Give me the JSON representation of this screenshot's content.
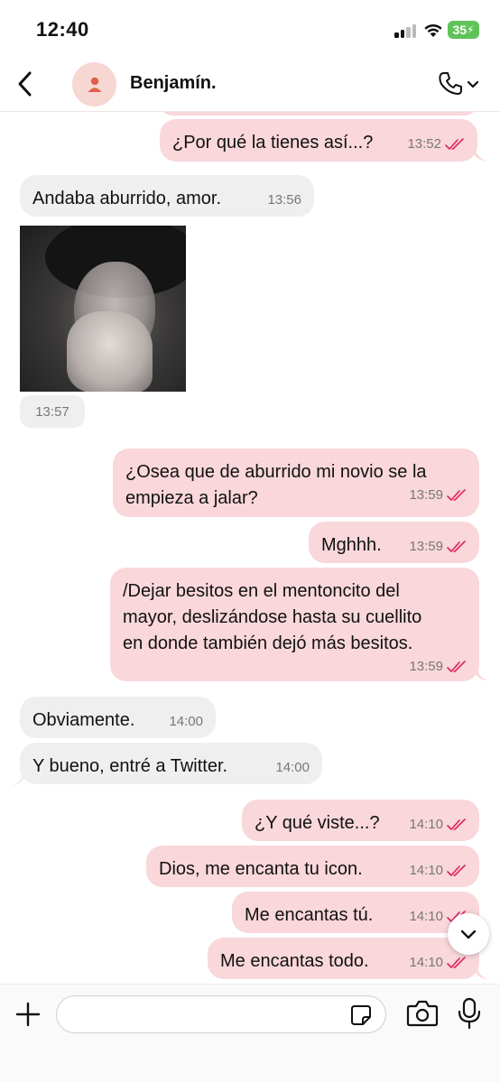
{
  "status_bar": {
    "time": "12:40",
    "battery": "35",
    "icons": [
      "signal-icon",
      "wifi-icon",
      "battery-charging-icon"
    ]
  },
  "header": {
    "contact_name": "Benjamín.",
    "icons": [
      "back-chevron-icon",
      "person-icon",
      "phone-icon",
      "chevron-down-icon"
    ]
  },
  "messages": [
    {
      "dir": "out",
      "text": "¿Por qué la tienes así...?",
      "time": "13:52",
      "read": true
    },
    {
      "dir": "in",
      "text": "Andaba aburrido, amor.",
      "time": "13:56"
    },
    {
      "dir": "in",
      "type": "photo",
      "time": "13:57"
    },
    {
      "dir": "out",
      "lines": [
        "¿Osea que de aburrido mi novio se la",
        "empieza a jalar?"
      ],
      "time": "13:59",
      "read": true
    },
    {
      "dir": "out",
      "text": "Mghhh.",
      "time": "13:59",
      "read": true
    },
    {
      "dir": "out",
      "lines": [
        "/Dejar besitos en el mentoncito del",
        "mayor, deslizándose hasta su cuellito",
        "en donde también dejó más besitos."
      ],
      "time": "13:59",
      "read": true
    },
    {
      "dir": "in",
      "text": "Obviamente.",
      "time": "14:00"
    },
    {
      "dir": "in",
      "text": "Y bueno, entré a Twitter.",
      "time": "14:00"
    },
    {
      "dir": "out",
      "text": "¿Y qué viste...?",
      "time": "14:10",
      "read": true
    },
    {
      "dir": "out",
      "text": "Dios, me encanta tu icon.",
      "time": "14:10",
      "read": true
    },
    {
      "dir": "out",
      "text": "Me encantas tú.",
      "time": "14:10",
      "read": true
    },
    {
      "dir": "out",
      "text": "Me encantas todo.",
      "time": "14:10",
      "read": true
    }
  ],
  "input_bar": {
    "placeholder": "",
    "icons": [
      "plus-icon",
      "sticker-icon",
      "camera-icon",
      "microphone-icon"
    ]
  },
  "colors": {
    "outgoing_bubble": "#f9d7db",
    "incoming_bubble": "#efefef",
    "read_ticks": "#e0245e",
    "avatar_bg": "#f7d7d2",
    "battery": "#5fc35a"
  }
}
